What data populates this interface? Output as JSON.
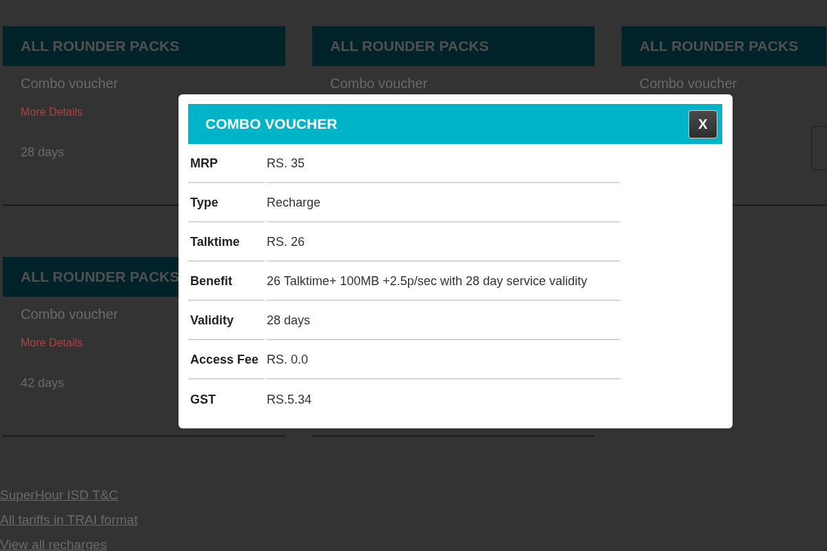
{
  "packs": [
    {
      "kind": "pack",
      "heading": "ALL ROUNDER PACKS",
      "name": "Combo voucher",
      "more_details": "More Details",
      "validity": "28 days"
    },
    {
      "kind": "pack",
      "heading": "ALL ROUNDER PACKS",
      "name": "Combo voucher"
    },
    {
      "kind": "pack",
      "heading": "ALL ROUNDER PACKS",
      "name": "Combo voucher",
      "has_button": true
    },
    {
      "kind": "pack",
      "heading": "ALL ROUNDER PACKS",
      "name": "Combo voucher",
      "more_details": "More Details",
      "validity": "42 days"
    },
    {
      "kind": "pack"
    }
  ],
  "links": [
    "SuperHour ISD T&C",
    "All tariffs in TRAI format",
    "View all recharges"
  ],
  "dialog": {
    "title": "COMBO VOUCHER",
    "close": "X",
    "details": [
      {
        "label": "MRP",
        "value": "RS. 35"
      },
      {
        "label": "Type",
        "value": "Recharge"
      },
      {
        "label": "Talktime",
        "value": "RS. 26"
      },
      {
        "label": "Benefit",
        "value": "26 Talktime+ 100MB +2.5p/sec with 28 day service validity"
      },
      {
        "label": "Validity",
        "value": "28 days"
      },
      {
        "label": "Access Fee",
        "value": "RS. 0.0"
      },
      {
        "label": "GST",
        "value": "RS.5.34"
      }
    ]
  }
}
